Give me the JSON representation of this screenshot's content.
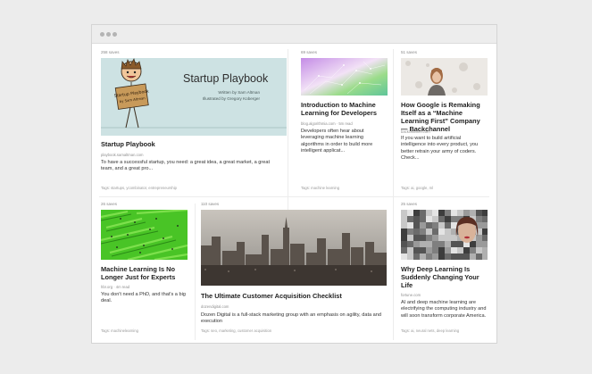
{
  "window": {
    "controls": [
      "close",
      "minimize",
      "maximize"
    ]
  },
  "cards": [
    {
      "saves": "258 saves",
      "title": "Startup Playbook",
      "source": "playbook.samaltman.com",
      "description": "To have a successful startup, you need: a great idea, a great market, a great team, and a great pro...",
      "tags": "Tags: startups, ycombinator, entrepreneurship",
      "image": {
        "title": "Startup Playbook",
        "author": "Written by Sam Altman",
        "illustrator": "Illustrated by Gregory Koberger",
        "sign": "Startup Playbook by Sam Altman"
      }
    },
    {
      "saves": "69 saves",
      "title": "Introduction to Machine Learning for Developers",
      "source": "blog.algorithmia.com · 5m read",
      "description": "Developers often hear about leveraging machine learning algorithms in order to build more intelligent applicat...",
      "tags": "Tags: machine learning"
    },
    {
      "saves": "51 saves",
      "title": "How Google is Remaking Itself as a “Machine Learning First” Company — Backchannel",
      "source": "backchannel.com",
      "description": "If you want to build artificial intelligence into every product, you better retrain your army of coders. Check...",
      "tags": "Tags: ai, google, ml"
    },
    {
      "saves": "26 saves",
      "title": "Machine Learning Is No Longer Just for Experts",
      "source": "hbr.org · 4m read",
      "description": "You don't need a PhD, and that's a big deal.",
      "tags": "Tags: machinelearning"
    },
    {
      "saves": "110 saves",
      "title": "The Ultimate Customer Acquisition Checklist",
      "source": "dozendigital.com",
      "description": "Dozen Digital is a full-stack marketing group with an emphasis on agility, data and execution",
      "tags": "Tags: seo, marketing, customer acquisition"
    },
    {
      "saves": "25 saves",
      "title": "Why Deep Learning Is Suddenly Changing Your Life",
      "source": "fortune.com",
      "description": "AI and deep machine learning are electrifying the computing industry and will soon transform corporate America.",
      "tags": "Tags: ai, neural nets, deep learning"
    }
  ]
}
